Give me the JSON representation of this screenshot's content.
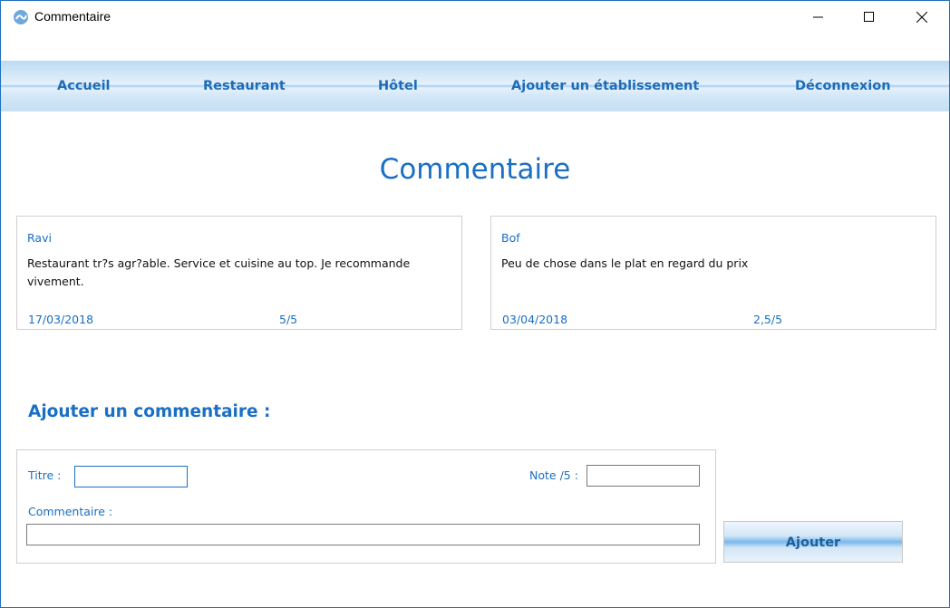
{
  "window": {
    "title": "Commentaire",
    "icon": "app-logo-icon",
    "controls": [
      "minimize-icon",
      "maximize-icon",
      "close-icon"
    ]
  },
  "nav": {
    "items": [
      {
        "label": "Accueil"
      },
      {
        "label": "Restaurant"
      },
      {
        "label": "Hôtel"
      },
      {
        "label": "Ajouter un établissement"
      },
      {
        "label": "Déconnexion"
      }
    ]
  },
  "page": {
    "title": "Commentaire"
  },
  "comments": [
    {
      "title": "Ravi",
      "body": "Restaurant tr?s agr?able. Service et cuisine au top. Je recommande vivement.",
      "date": "17/03/2018",
      "score": "5/5"
    },
    {
      "title": "Bof",
      "body": "Peu de chose dans le plat en regard du prix",
      "date": "03/04/2018",
      "score": "2,5/5"
    }
  ],
  "add_form": {
    "heading": "Ajouter un commentaire :",
    "title_label": "Titre :",
    "title_value": "",
    "note_label": "Note /5 :",
    "note_value": "",
    "comment_label": "Commentaire :",
    "comment_value": "",
    "submit_label": "Ajouter"
  },
  "colors": {
    "accent": "#1a6fc4",
    "nav_text": "#1c6cb8",
    "window_border": "#1f6fbf"
  }
}
